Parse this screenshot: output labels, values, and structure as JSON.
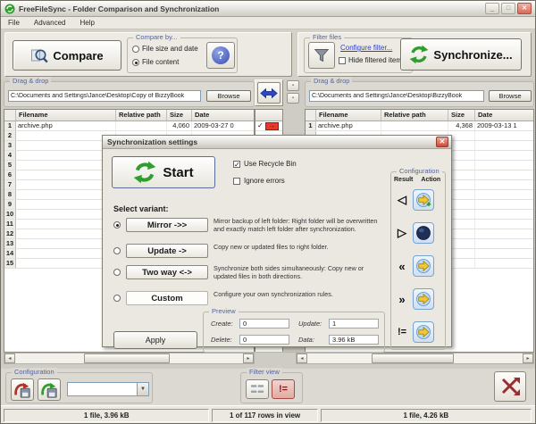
{
  "colors": {
    "accent_green": "#2f9e2f",
    "accent_blue": "#2244bb",
    "alert_red": "#cf4936",
    "badge_red": "#e23b30",
    "link_blue": "#2b3fd0",
    "group_label_blue": "#54659c"
  },
  "icons": {
    "app": "app-icon",
    "compare": "magnifier-icon",
    "help": "question-icon",
    "filter": "funnel-icon",
    "synchronize": "green-sync-arrows-icon",
    "swap": "blue-double-arrow-icon",
    "exclude": "red-crossed-arrows-icon"
  },
  "window": {
    "title": "FreeFileSync - Folder Comparison and Synchronization",
    "menu_items": [
      "File",
      "Advanced",
      "Help"
    ],
    "minimize": "_",
    "maximize": "□",
    "close": "✕"
  },
  "toolbar": {
    "compare_label": "Compare",
    "compare_by_label": "Compare by...",
    "radio_size_date": "File size and date",
    "radio_content": "File content",
    "filter_files_label": "Filter files",
    "configure_filter_link": "Configure filter...",
    "hide_filtered_label": "Hide filtered items",
    "synchronize_label": "Synchronize..."
  },
  "left_panel": {
    "group_label": "Drag & drop",
    "path": "C:\\Documents and Settings\\Jance\\Desktop\\Copy of BizzyBook",
    "browse": "Browse",
    "columns": {
      "filename": "Filename",
      "relative_path": "Relative path",
      "size": "Size",
      "date": "Date"
    },
    "row1": {
      "num": "1",
      "filename": "archive.php",
      "relative_path": "",
      "size": "4,060",
      "date": "2009-03-27 0"
    },
    "empty_row_numbers": [
      "2",
      "3",
      "4",
      "5",
      "6",
      "7",
      "8",
      "9",
      "10",
      "11",
      "12",
      "13",
      "14",
      "15"
    ]
  },
  "right_panel": {
    "group_label": "Drag & drop",
    "path": "C:\\Documents and Settings\\Jance\\Desktop\\BizzyBook",
    "browse": "Browse",
    "columns": {
      "filename": "Filename",
      "relative_path": "Relative path",
      "size": "Size",
      "date": "Date"
    },
    "row1": {
      "num": "1",
      "filename": "archive.php",
      "relative_path": "",
      "size": "4,368",
      "date": "2009-03-13 1"
    },
    "empty_row_numbers": [
      "",
      "",
      "",
      "",
      "",
      "",
      "",
      "",
      "",
      "",
      "",
      "",
      "",
      ""
    ]
  },
  "middle": {
    "row1_check": "✓",
    "row1_direction": "→"
  },
  "dialog": {
    "title": "Synchronization settings",
    "start_label": "Start",
    "use_recycle_label": "Use Recycle Bin",
    "use_recycle_checked": "✓",
    "ignore_errors_label": "Ignore errors",
    "select_variant_label": "Select variant:",
    "variants": [
      {
        "label": "Mirror ->>",
        "desc": "Mirror backup of left folder: Right folder will be overwritten and exactly match left folder after synchronization."
      },
      {
        "label": "Update ->",
        "desc": "Copy new or updated files to right folder."
      },
      {
        "label": "Two way <->",
        "desc": "Synchronize both sides simultaneously: Copy new or updated files in both directions."
      },
      {
        "label": "Custom",
        "desc": "Configure your own synchronization rules."
      }
    ],
    "configuration": {
      "label": "Configuration",
      "result_header": "Result",
      "action_header": "Action",
      "results": [
        "◁",
        "▷",
        "«",
        "»",
        "!="
      ]
    },
    "preview": {
      "label": "Preview",
      "create_label": "Create:",
      "create_value": "0",
      "delete_label": "Delete:",
      "delete_value": "0",
      "update_label": "Update:",
      "update_value": "1",
      "data_label": "Data:",
      "data_value": "3.96 kB"
    },
    "apply_label": "Apply"
  },
  "bottom": {
    "configuration_label": "Configuration",
    "filter_view_label": "Filter view",
    "neq_label": "!="
  },
  "statusbar": [
    "1 file, 3.96 kB",
    "1 of 117 rows in view",
    "1 file, 4.26 kB"
  ]
}
